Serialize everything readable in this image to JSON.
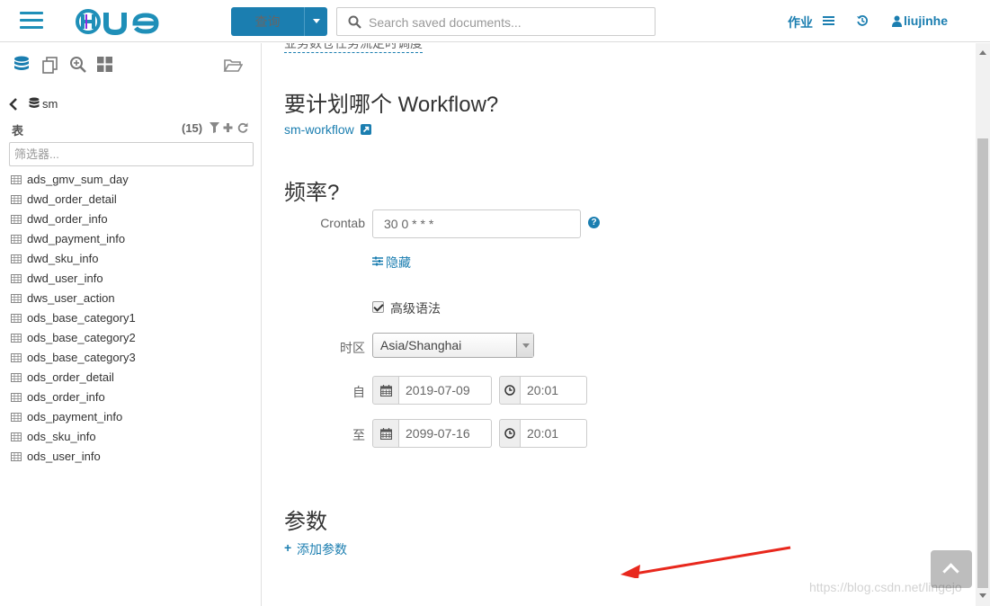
{
  "topbar": {
    "logo_text": "HUE",
    "query_button": "查询",
    "search_placeholder": "Search saved documents...",
    "jobs_label": "作业",
    "username": "liujinhe"
  },
  "colors": {
    "accent": "#1b7eb0",
    "arrow": "#e8281d"
  },
  "sidebar": {
    "database": "sm",
    "tables_label": "表",
    "tables_count": "(15)",
    "filter_placeholder": "筛选器...",
    "tables": [
      "ads_gmv_sum_day",
      "dwd_order_detail",
      "dwd_order_info",
      "dwd_payment_info",
      "dwd_sku_info",
      "dwd_user_info",
      "dws_user_action",
      "ods_base_category1",
      "ods_base_category2",
      "ods_base_category3",
      "ods_order_detail",
      "ods_order_info",
      "ods_payment_info",
      "ods_sku_info",
      "ods_user_info"
    ]
  },
  "main": {
    "cut_off_text": "业务数仓任务流定时调度",
    "workflow_heading": "要计划哪个 Workflow?",
    "workflow_link": "sm-workflow",
    "frequency_heading": "频率?",
    "crontab_label": "Crontab",
    "crontab_value": "30 0 * * *",
    "hide_link": "隐藏",
    "advanced_syntax_label": "高级语法",
    "timezone_label": "时区",
    "timezone_value": "Asia/Shanghai",
    "start_label": "自",
    "start_date": "2019-07-09",
    "start_time": "20:01",
    "end_label": "至",
    "end_date": "2099-07-16",
    "end_time": "20:01",
    "params_heading": "参数",
    "add_param_link": "添加参数"
  },
  "watermark": "https://blog.csdn.net/lingejo"
}
